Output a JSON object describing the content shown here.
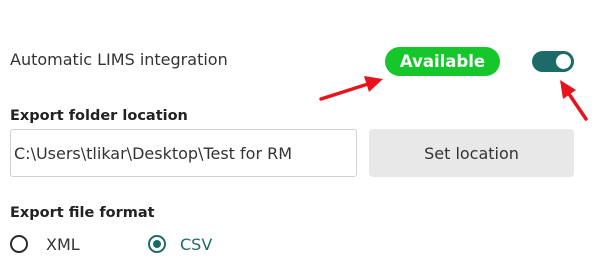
{
  "integration": {
    "label": "Automatic LIMS integration",
    "status": "Available",
    "toggle_on": true
  },
  "export_folder": {
    "label": "Export folder location",
    "path_value": "C:\\Users\\tlikar\\Desktop\\Test for RM",
    "button_label": "Set location"
  },
  "export_format": {
    "label": "Export file format",
    "options": [
      {
        "label": "XML",
        "selected": false
      },
      {
        "label": "CSV",
        "selected": true
      }
    ]
  },
  "colors": {
    "status_badge": "#15c72a",
    "accent": "#1d6b68",
    "annotation_arrow": "#e8131b"
  }
}
